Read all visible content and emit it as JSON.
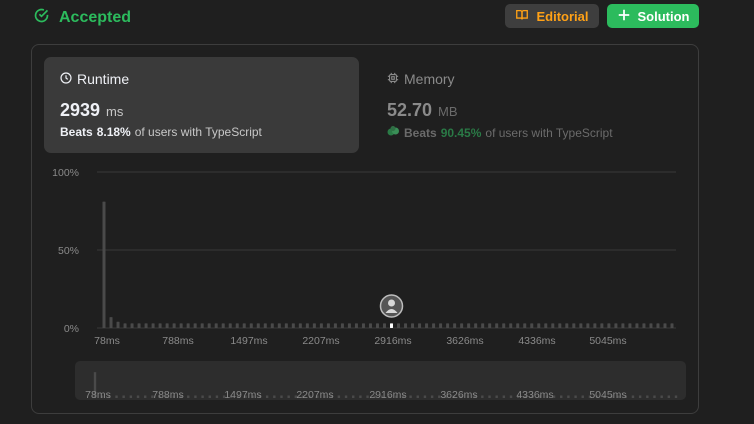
{
  "status": {
    "text": "Accepted",
    "color": "#2cbb5d"
  },
  "buttons": {
    "editorial": {
      "label": "Editorial",
      "icon": "book-icon"
    },
    "solution": {
      "label": "Solution",
      "icon": "plus-icon"
    }
  },
  "runtime": {
    "title": "Runtime",
    "icon": "clock-icon",
    "value": "2939",
    "unit": "ms",
    "beats_label": "Beats",
    "beats_pct": "8.18%",
    "beats_tail": "of users with TypeScript"
  },
  "memory": {
    "title": "Memory",
    "icon": "chip-icon",
    "value": "52.70",
    "unit": "MB",
    "beats_label": "Beats",
    "beats_pct": "90.45%",
    "beats_tail": "of users with TypeScript"
  },
  "chart_data": {
    "type": "bar",
    "ytick_labels": [
      "100%",
      "50%",
      "0%"
    ],
    "ylim": [
      0,
      100
    ],
    "xtick_labels": [
      "78ms",
      "788ms",
      "1497ms",
      "2207ms",
      "2916ms",
      "3626ms",
      "4336ms",
      "5045ms"
    ],
    "values": [
      81,
      7,
      4,
      3,
      3,
      3,
      3,
      3,
      3,
      3,
      3,
      3,
      3,
      3,
      3,
      3,
      3,
      3,
      3,
      3,
      3,
      3,
      3,
      3,
      3,
      3,
      3,
      3,
      3,
      3,
      3,
      3,
      3,
      3,
      3,
      3,
      3,
      3,
      3,
      3,
      3,
      3,
      3,
      3,
      3,
      3,
      3,
      3,
      3,
      3,
      3,
      3,
      3,
      3,
      3,
      3,
      3,
      3,
      3,
      3,
      3,
      3,
      3,
      3,
      3,
      3,
      3,
      3,
      3,
      3,
      3,
      3,
      3,
      3,
      3,
      3,
      3,
      3,
      3,
      3,
      3,
      3
    ],
    "highlight_label": "2916ms",
    "grid": true,
    "colors": {
      "bar": "#4a4a4a",
      "highlight": "#ffffff",
      "grid": "#3a3a3a",
      "tick": "#8a8a8a"
    }
  },
  "navigator": {
    "xtick_labels": [
      "78ms",
      "788ms",
      "1497ms",
      "2207ms",
      "2916ms",
      "3626ms",
      "4336ms",
      "5045ms"
    ]
  }
}
